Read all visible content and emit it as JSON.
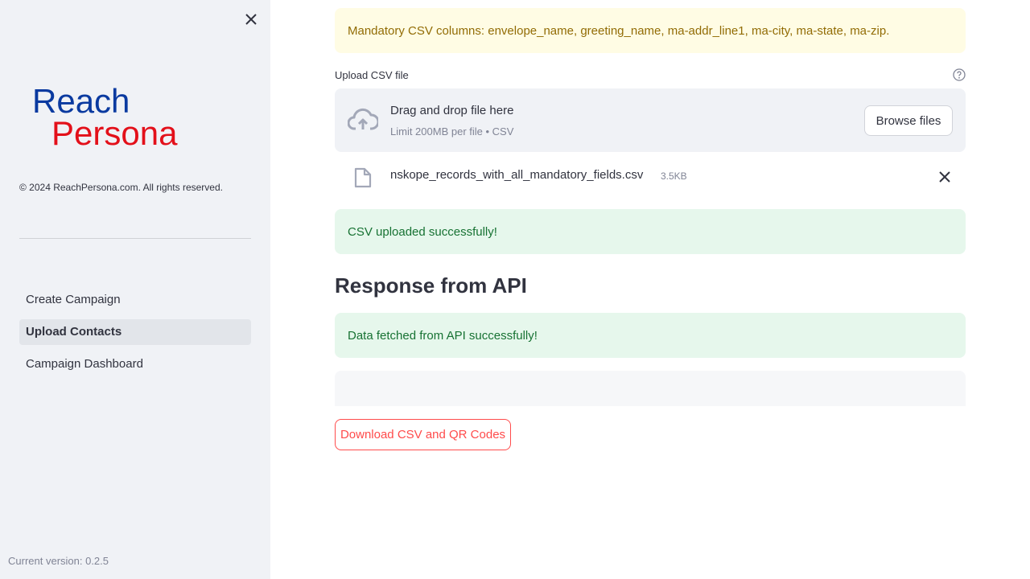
{
  "sidebar": {
    "close_icon": "close-icon",
    "logo": {
      "line1": "Reach",
      "line2": "Persona",
      "line1_color": "#0a3aa0",
      "line2_color": "#e3101a"
    },
    "copyright": "© 2024 ReachPersona.com. All rights reserved.",
    "nav": [
      {
        "label": "Create Campaign",
        "active": false
      },
      {
        "label": "Upload Contacts",
        "active": true
      },
      {
        "label": "Campaign Dashboard",
        "active": false
      }
    ],
    "version": "Current version: 0.2.5"
  },
  "main": {
    "warning": "Mandatory CSV columns: envelope_name, greeting_name, ma-addr_line1, ma-city, ma-state, ma-zip.",
    "upload": {
      "label": "Upload CSV file",
      "help_icon": "help-circle-icon",
      "drop_title": "Drag and drop file here",
      "drop_limit": "Limit 200MB per file • CSV",
      "browse_label": "Browse files",
      "cloud_icon": "cloud-upload-icon"
    },
    "file": {
      "name": "nskope_records_with_all_mandatory_fields.csv",
      "size": "3.5KB",
      "file_icon": "file-icon",
      "remove_icon": "close-icon"
    },
    "success_upload": "CSV uploaded successfully!",
    "section_title": "Response from API",
    "success_api": "Data fetched from API successfully!",
    "download_label": "Download CSV and QR Codes"
  },
  "colors": {
    "accent": "#ff4b4b",
    "warning_bg": "#fffce4",
    "warning_text": "#926c05",
    "success_bg": "#e6f7ec",
    "success_text": "#177233",
    "sidebar_bg": "#f0f2f6"
  }
}
